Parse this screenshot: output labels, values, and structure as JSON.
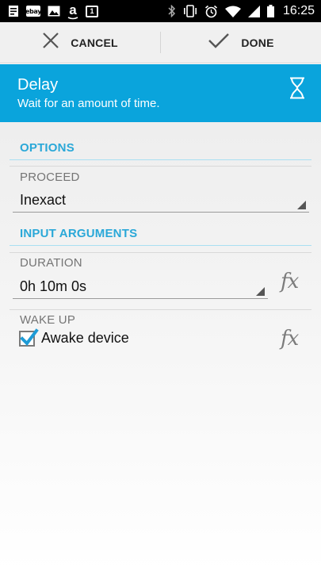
{
  "status_bar": {
    "left_icons": [
      "notes-icon",
      "ebay-icon",
      "gallery-icon",
      "amazon-icon",
      "calendar-icon"
    ],
    "ebay_text": "ebay",
    "amazon_text": "a",
    "calendar_number": "1",
    "right_icons": [
      "bluetooth-icon",
      "vibrate-icon",
      "alarm-icon",
      "wifi-icon",
      "signal-icon",
      "battery-icon"
    ],
    "time": "16:25"
  },
  "action_bar": {
    "cancel_label": "CANCEL",
    "done_label": "DONE"
  },
  "header": {
    "title": "Delay",
    "subtitle": "Wait for an amount of time.",
    "icon": "hourglass-icon",
    "background": "#0aa4dc"
  },
  "options": {
    "section_title": "OPTIONS",
    "proceed_label": "PROCEED",
    "proceed_value": "Inexact"
  },
  "input_arguments": {
    "section_title": "INPUT ARGUMENTS",
    "duration_label": "DURATION",
    "duration_value": "0h 10m 0s",
    "wake_up_label": "WAKE UP",
    "awake_device_label": "Awake device",
    "awake_device_checked": true,
    "fx_label": "fx"
  },
  "colors": {
    "accent": "#2aa8d8",
    "checkbox_check": "#1e9bd6"
  }
}
